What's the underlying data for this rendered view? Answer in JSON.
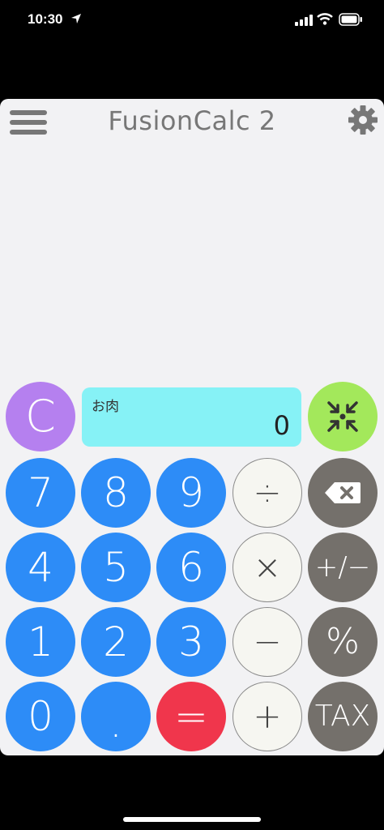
{
  "status_bar": {
    "time": "10:30"
  },
  "app": {
    "title": "FusionCalc 2"
  },
  "display": {
    "label": "お肉",
    "value": "0"
  },
  "keys": {
    "clear": "C",
    "seven": "7",
    "eight": "8",
    "nine": "9",
    "four": "4",
    "five": "5",
    "six": "6",
    "one": "1",
    "two": "2",
    "three": "3",
    "zero": "0",
    "dot": ".",
    "equals": "=",
    "divide": "÷",
    "multiply": "×",
    "minus": "−",
    "plus": "+",
    "plus_minus": "+/−",
    "percent": "%",
    "tax": "TAX"
  },
  "colors": {
    "number_key": "#2d8cf7",
    "clear_key": "#b580ef",
    "shrink_key": "#a3e85b",
    "equals_key": "#f0364c",
    "function_key": "#74706b",
    "operator_key": "#f6f6f1",
    "display_bg": "#86f2f6"
  },
  "icons": [
    "location-arrow-icon",
    "signal-icon",
    "wifi-icon",
    "battery-icon",
    "menu-icon",
    "gear-icon",
    "shrink-icon",
    "backspace-icon"
  ]
}
